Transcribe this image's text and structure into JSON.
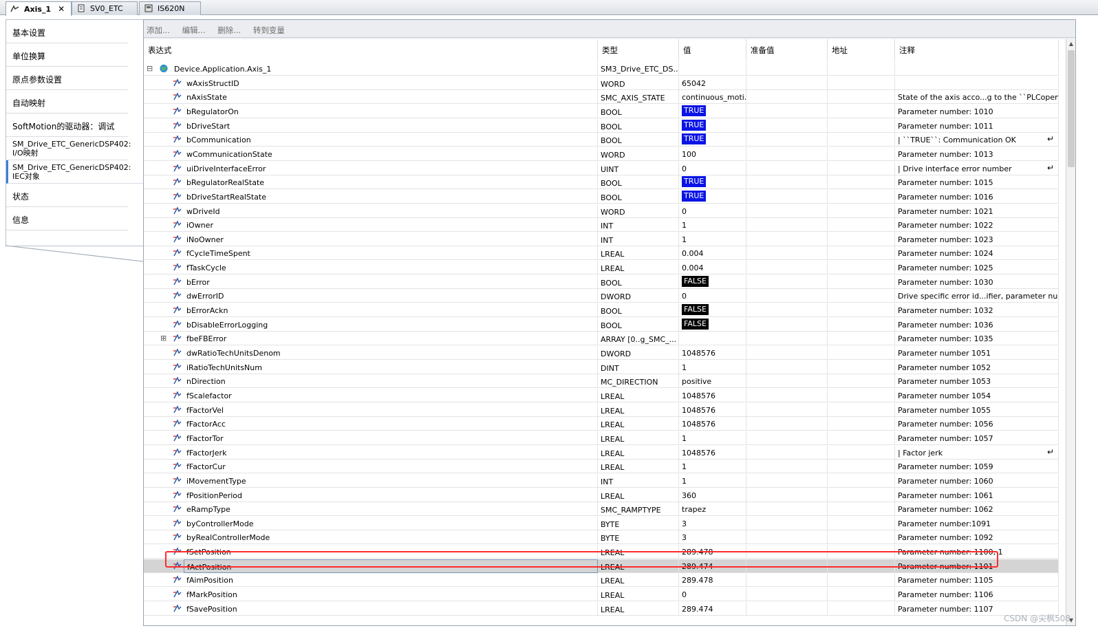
{
  "tabs": [
    {
      "label": "Axis_1",
      "icon": "axis-icon",
      "active": true
    },
    {
      "label": "SV0_ETC",
      "icon": "document-icon",
      "active": false
    },
    {
      "label": "IS620N",
      "icon": "device-icon",
      "active": false
    }
  ],
  "sidebar": {
    "items": [
      {
        "label": "基本设置"
      },
      {
        "label": "单位换算"
      },
      {
        "label": "原点参数设置"
      },
      {
        "label": "自动映射"
      },
      {
        "label": "SoftMotion的驱动器：调试"
      },
      {
        "label": "SM_Drive_ETC_GenericDSP402: I/O映射"
      },
      {
        "label": "SM_Drive_ETC_GenericDSP402: IEC对象"
      },
      {
        "label": "状态"
      },
      {
        "label": "信息"
      }
    ]
  },
  "toolbar": {
    "add": "添加...",
    "edit": "编辑...",
    "delete": "删除...",
    "goto": "转到变量"
  },
  "columns": {
    "expr": "表达式",
    "type": "类型",
    "value": "值",
    "prepared": "准备值",
    "address": "地址",
    "comment": "注释"
  },
  "root": {
    "expr": "Device.Application.Axis_1",
    "type": "SM3_Drive_ETC_DS...",
    "toggle": "⊟"
  },
  "rows": [
    {
      "expr": "wAxisStructID",
      "type": "WORD",
      "value": "65042",
      "comment": ""
    },
    {
      "expr": "nAxisState",
      "type": "SMC_AXIS_STATE",
      "value": "continuous_moti...",
      "comment": "State of the axis acco...g to the ``PLCopen..."
    },
    {
      "expr": "bRegulatorOn",
      "type": "BOOL",
      "value": "TRUE",
      "style": "t",
      "comment": "Parameter number: 1010"
    },
    {
      "expr": "bDriveStart",
      "type": "BOOL",
      "value": "TRUE",
      "style": "t",
      "comment": "Parameter number: 1011"
    },
    {
      "expr": "bCommunication",
      "type": "BOOL",
      "value": "TRUE",
      "style": "t",
      "comment": "| ``TRUE``: Communication OK",
      "enter": "↵"
    },
    {
      "expr": "wCommunicationState",
      "type": "WORD",
      "value": "100",
      "comment": "Parameter number: 1013"
    },
    {
      "expr": "uiDriveInterfaceError",
      "type": "UINT",
      "value": "0",
      "comment": "| Drive interface error number",
      "enter": "↵"
    },
    {
      "expr": "bRegulatorRealState",
      "type": "BOOL",
      "value": "TRUE",
      "style": "t",
      "comment": "Parameter number: 1015"
    },
    {
      "expr": "bDriveStartRealState",
      "type": "BOOL",
      "value": "TRUE",
      "style": "t",
      "comment": "Parameter number: 1016"
    },
    {
      "expr": "wDriveId",
      "type": "WORD",
      "value": "0",
      "comment": "Parameter number: 1021"
    },
    {
      "expr": "iOwner",
      "type": "INT",
      "value": "1",
      "comment": "Parameter number: 1022"
    },
    {
      "expr": "iNoOwner",
      "type": "INT",
      "value": "1",
      "comment": "Parameter number: 1023"
    },
    {
      "expr": "fCycleTimeSpent",
      "type": "LREAL",
      "value": "0.004",
      "comment": "Parameter number: 1024"
    },
    {
      "expr": "fTaskCycle",
      "type": "LREAL",
      "value": "0.004",
      "comment": "Parameter number: 1025"
    },
    {
      "expr": "bError",
      "type": "BOOL",
      "value": "FALSE",
      "style": "f",
      "comment": "Parameter number: 1030"
    },
    {
      "expr": "dwErrorID",
      "type": "DWORD",
      "value": "0",
      "comment": "Drive specific error id...ifier, parameter num..."
    },
    {
      "expr": "bErrorAckn",
      "type": "BOOL",
      "value": "FALSE",
      "style": "f",
      "comment": "Parameter number: 1032"
    },
    {
      "expr": "bDisableErrorLogging",
      "type": "BOOL",
      "value": "FALSE",
      "style": "f",
      "comment": "Parameter number: 1036"
    },
    {
      "expr": "fbeFBError",
      "type": "ARRAY [0..g_SMC_...",
      "value": "",
      "comment": "Parameter number: 1035",
      "toggle": "⊞"
    },
    {
      "expr": "dwRatioTechUnitsDenom",
      "type": "DWORD",
      "value": "1048576",
      "comment": "Parameter number 1051"
    },
    {
      "expr": "iRatioTechUnitsNum",
      "type": "DINT",
      "value": "1",
      "comment": "Parameter number 1052"
    },
    {
      "expr": "nDirection",
      "type": "MC_DIRECTION",
      "value": "positive",
      "comment": "Parameter number 1053"
    },
    {
      "expr": "fScalefactor",
      "type": "LREAL",
      "value": "1048576",
      "comment": "Parameter number 1054"
    },
    {
      "expr": "fFactorVel",
      "type": "LREAL",
      "value": "1048576",
      "comment": "Parameter number 1055"
    },
    {
      "expr": "fFactorAcc",
      "type": "LREAL",
      "value": "1048576",
      "comment": "Parameter number: 1056"
    },
    {
      "expr": "fFactorTor",
      "type": "LREAL",
      "value": "1",
      "comment": "Parameter number: 1057"
    },
    {
      "expr": "fFactorJerk",
      "type": "LREAL",
      "value": "1048576",
      "comment": "| Factor jerk",
      "enter": "↵"
    },
    {
      "expr": "fFactorCur",
      "type": "LREAL",
      "value": "1",
      "comment": "Parameter number: 1059"
    },
    {
      "expr": "iMovementType",
      "type": "INT",
      "value": "1",
      "comment": "Parameter number: 1060"
    },
    {
      "expr": "fPositionPeriod",
      "type": "LREAL",
      "value": "360",
      "comment": "Parameter number: 1061"
    },
    {
      "expr": "eRampType",
      "type": "SMC_RAMPTYPE",
      "value": "trapez",
      "comment": "Parameter number: 1062"
    },
    {
      "expr": "byControllerMode",
      "type": "BYTE",
      "value": "3",
      "comment": "Parameter number:1091"
    },
    {
      "expr": "byRealControllerMode",
      "type": "BYTE",
      "value": "3",
      "comment": "Parameter number: 1092"
    },
    {
      "expr": "fSetPosition",
      "type": "LREAL",
      "value": "289.478",
      "comment": "Parameter number: 1100, 1"
    },
    {
      "expr": "fActPosition",
      "type": "LREAL",
      "value": "289.474",
      "comment": "Parameter number: 1101",
      "selected": true
    },
    {
      "expr": "fAimPosition",
      "type": "LREAL",
      "value": "289.478",
      "comment": "Parameter number: 1105"
    },
    {
      "expr": "fMarkPosition",
      "type": "LREAL",
      "value": "0",
      "comment": "Parameter number: 1106"
    },
    {
      "expr": "fSavePosition",
      "type": "LREAL",
      "value": "289.474",
      "comment": "Parameter number: 1107"
    }
  ],
  "watermark": "CSDN @尖枫508",
  "colors": {
    "true_bg": "#0a14e6",
    "false_bg": "#000000",
    "highlight": "#ff2a2a"
  }
}
